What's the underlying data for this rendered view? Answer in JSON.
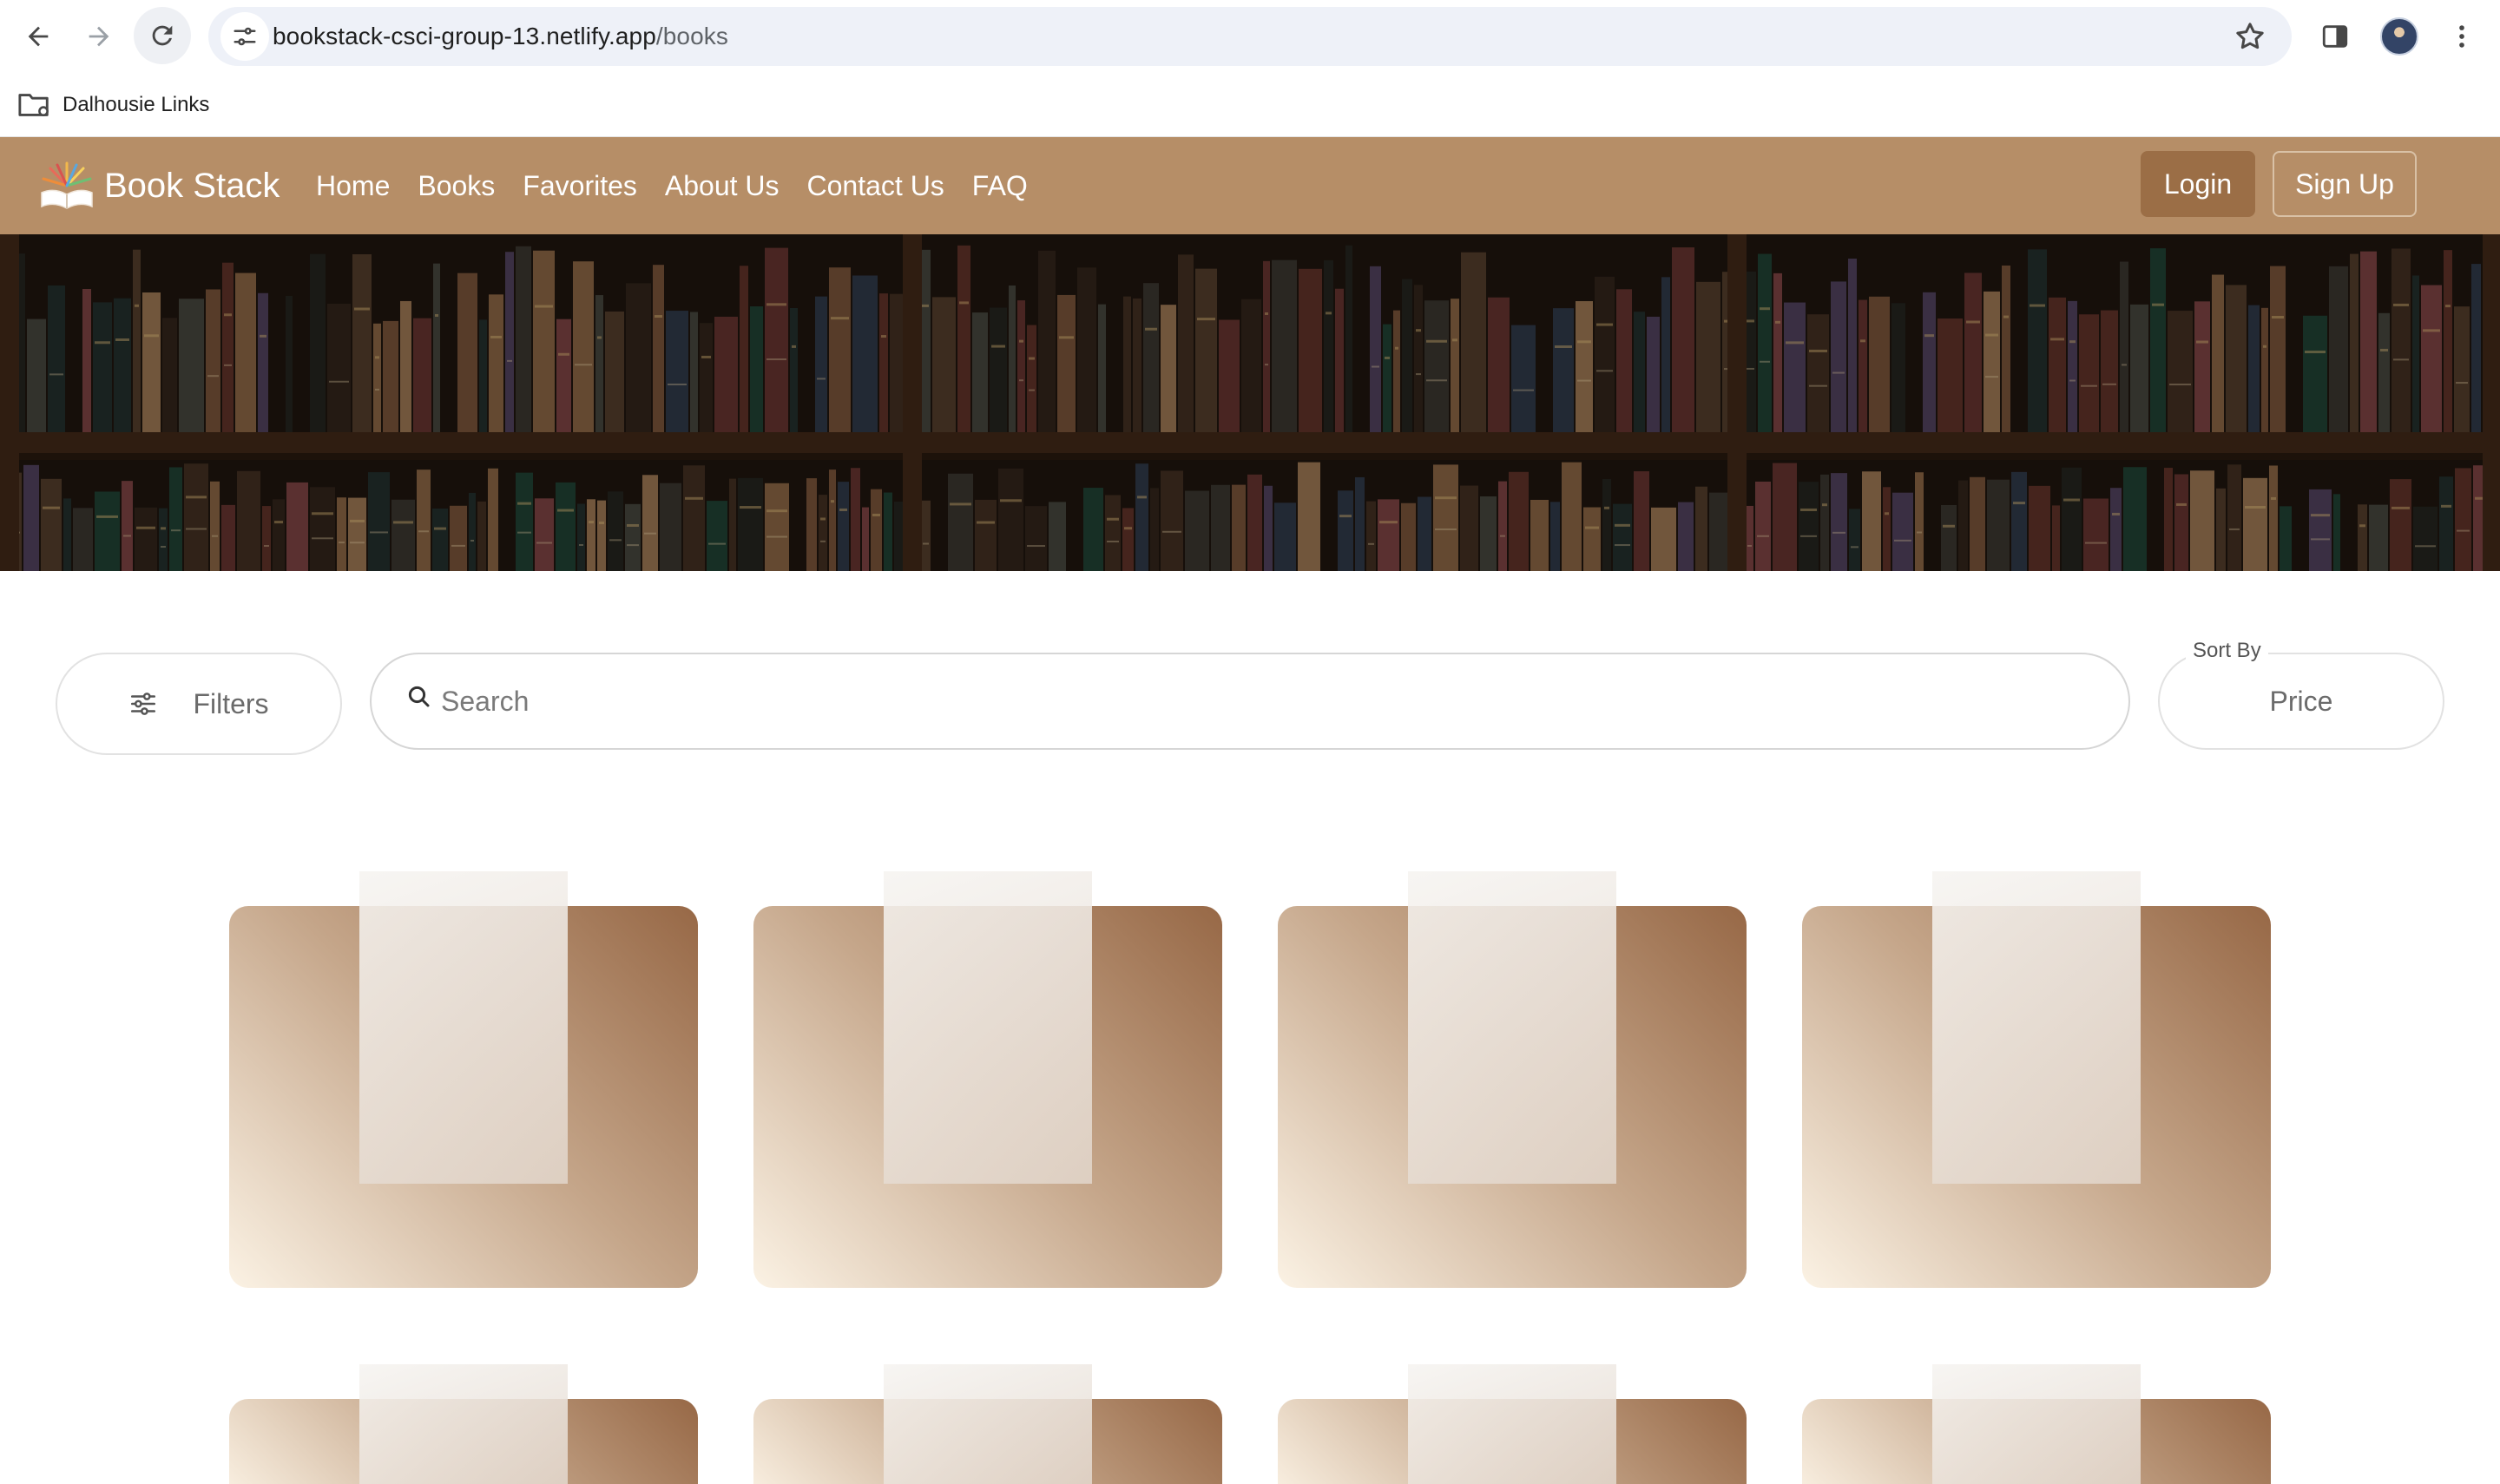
{
  "browser": {
    "url_host": "bookstack-csci-group-13.netlify.app",
    "url_path": "/books",
    "bookmarks": [
      {
        "label": "Dalhousie Links",
        "icon": "folder-icon"
      }
    ]
  },
  "navbar": {
    "brand": "Book Stack",
    "brand_icon": "open-book-logo-icon",
    "links": [
      "Home",
      "Books",
      "Favorites",
      "About Us",
      "Contact Us",
      "FAQ"
    ],
    "login_label": "Login",
    "signup_label": "Sign Up",
    "colors": {
      "bar": "#b68e67",
      "login_button": "#9b6e46"
    }
  },
  "hero": {
    "image": "bookshelf-banner"
  },
  "controls": {
    "filters_label": "Filters",
    "filters_icon": "sliders-icon",
    "search_placeholder": "Search",
    "search_icon": "search-icon",
    "sort_label": "Sort By",
    "sort_value": "Price"
  },
  "books": {
    "state": "loading-skeleton",
    "visible_placeholders": 8
  }
}
